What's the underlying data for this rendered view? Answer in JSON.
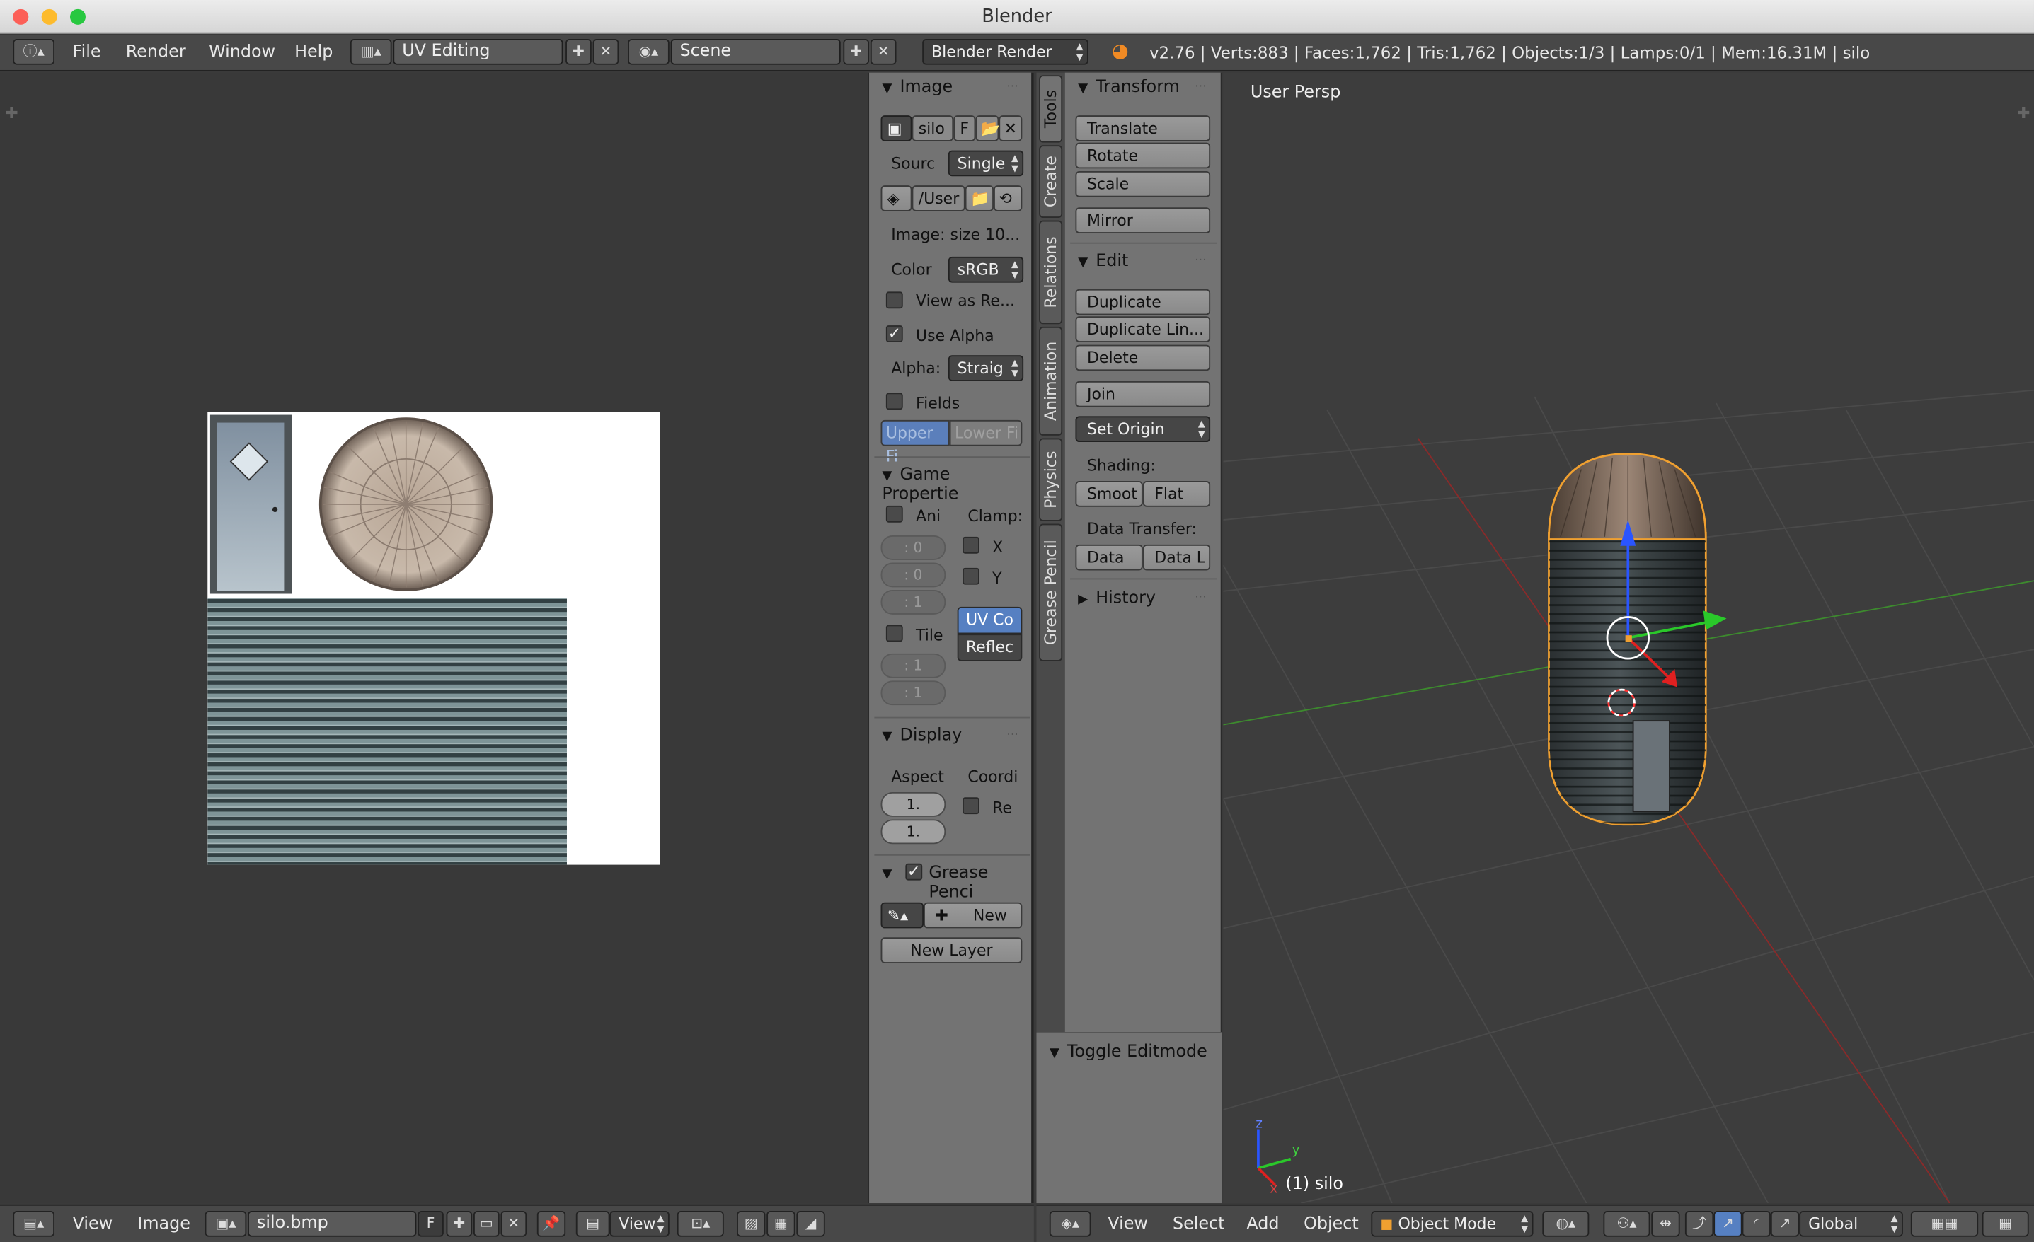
{
  "window": {
    "title": "Blender"
  },
  "topbar": {
    "menus": [
      "File",
      "Render",
      "Window",
      "Help"
    ],
    "layout": "UV Editing",
    "scene": "Scene",
    "engine": "Blender Render",
    "stats": "v2.76 | Verts:883 | Faces:1,762 | Tris:1,762 | Objects:1/3 | Lamps:0/1 | Mem:16.31M | silo"
  },
  "image_panel": {
    "image_header": "Image",
    "image_name": "silo",
    "fake_user": "F",
    "source_label": "Sourc",
    "source_value": "Single",
    "filepath": "/User",
    "image_info": "Image: size 10...",
    "color_label": "Color",
    "color_value": "sRGB",
    "view_as_render": "View as Re...",
    "use_alpha": "Use Alpha",
    "alpha_label": "Alpha:",
    "alpha_value": "Straig",
    "fields": "Fields",
    "upper_field": "Upper Fi",
    "lower_field": "Lower Fi",
    "game_header": "Game Propertie",
    "ani": "Ani",
    "clamp": "Clamp:",
    "num1": ": 0",
    "num2": ": 0",
    "num3": ": 1",
    "clamp_x": "X",
    "clamp_y": "Y",
    "uv_coord": "UV Co",
    "reflection": "Reflec",
    "tile": "Tile",
    "num4": ": 1",
    "num5": ": 1",
    "display_header": "Display",
    "aspect": "Aspect",
    "coords": "Coordi",
    "aspect_x": "1.",
    "aspect_y": "1.",
    "repeat": "Re",
    "gp_header": "Grease Penci",
    "gp_new": "New",
    "gp_new_layer": "New Layer"
  },
  "tabs": [
    "Tools",
    "Create",
    "Relations",
    "Animation",
    "Physics",
    "Grease Pencil"
  ],
  "tool_panel": {
    "transform_header": "Transform",
    "translate": "Translate",
    "rotate": "Rotate",
    "scale": "Scale",
    "mirror": "Mirror",
    "edit_header": "Edit",
    "duplicate": "Duplicate",
    "duplicate_linked": "Duplicate Lin...",
    "delete": "Delete",
    "join": "Join",
    "set_origin": "Set Origin",
    "shading": "Shading:",
    "smooth": "Smoot",
    "flat": "Flat",
    "data_transfer": "Data Transfer:",
    "data": "Data",
    "data_layout": "Data L",
    "history": "History",
    "toggle_editmode": "Toggle Editmode"
  },
  "viewport": {
    "label": "User Persp",
    "object_label": "(1) silo",
    "axis_x": "x",
    "axis_y": "y",
    "axis_z": "z"
  },
  "uv_bottom": {
    "view": "View",
    "image": "Image",
    "image_name": "silo.bmp",
    "fake": "F",
    "view2": "View"
  },
  "v3d_bottom": {
    "view": "View",
    "select": "Select",
    "add": "Add",
    "object": "Object",
    "mode": "Object Mode",
    "orientation": "Global"
  },
  "colors": {
    "accent": "#5680c2",
    "selection": "#f0a030",
    "grid_x": "#8a2a2a",
    "grid_y": "#3a8a2a"
  }
}
